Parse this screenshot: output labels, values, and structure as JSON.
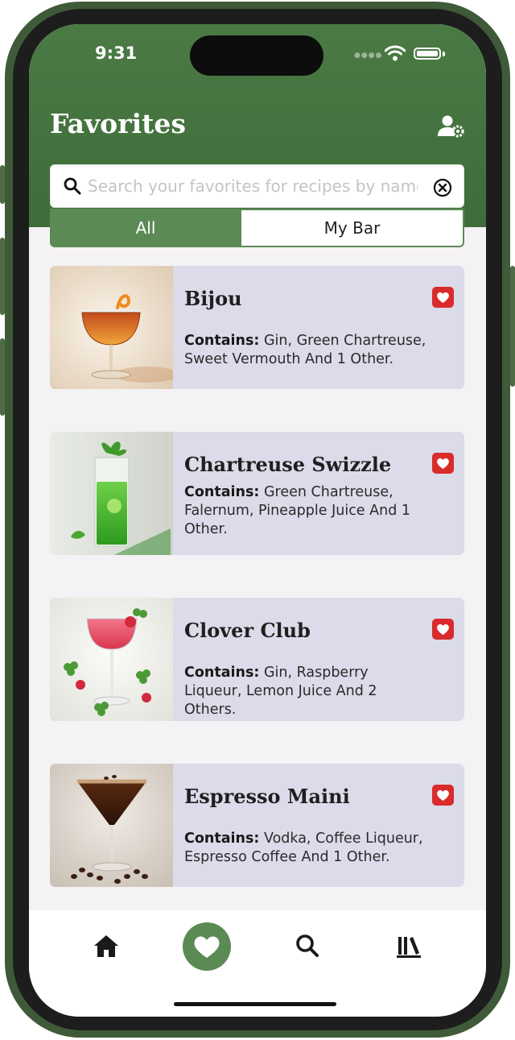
{
  "status_bar": {
    "time": "9:31"
  },
  "header": {
    "title": "Favorites",
    "search_placeholder": "Search your favorites for recipes by name",
    "search_value": ""
  },
  "tabs": [
    {
      "label": "All",
      "selected": true
    },
    {
      "label": "My Bar",
      "selected": false
    }
  ],
  "contains_label": "Contains:",
  "recipes": [
    {
      "name": "Bijou",
      "ingredients": "Gin, Green Chartreuse, Sweet Vermouth And 1 Other.",
      "favorited": true,
      "image": "amber-coupe-cocktail-with-orange-twist"
    },
    {
      "name": "Chartreuse Swizzle",
      "ingredients": "Green Chartreuse, Falernum, Pineapple Juice And 1 Other.",
      "favorited": true,
      "image": "green-highball-cocktail-with-mint"
    },
    {
      "name": "Clover Club",
      "ingredients": "Gin, Raspberry Liqueur, Lemon Juice And 2 Others.",
      "favorited": true,
      "image": "pink-coupe-cocktail-with-clover-and-raspberries"
    },
    {
      "name": "Espresso Maini",
      "ingredients": "Vodka, Coffee Liqueur, Espresso Coffee And 1 Other.",
      "favorited": true,
      "image": "espresso-martini-with-coffee-beans"
    }
  ],
  "bottom_nav": [
    {
      "icon": "home-icon",
      "active": false
    },
    {
      "icon": "heart-icon",
      "active": true
    },
    {
      "icon": "search-icon",
      "active": false
    },
    {
      "icon": "library-icon",
      "active": false
    }
  ],
  "colors": {
    "header_green": "#4b7a45",
    "tab_green": "#5b8a55",
    "card_lavender": "#dcdbea",
    "favorite_red": "#d92b2b",
    "background": "#f4f2f4"
  }
}
